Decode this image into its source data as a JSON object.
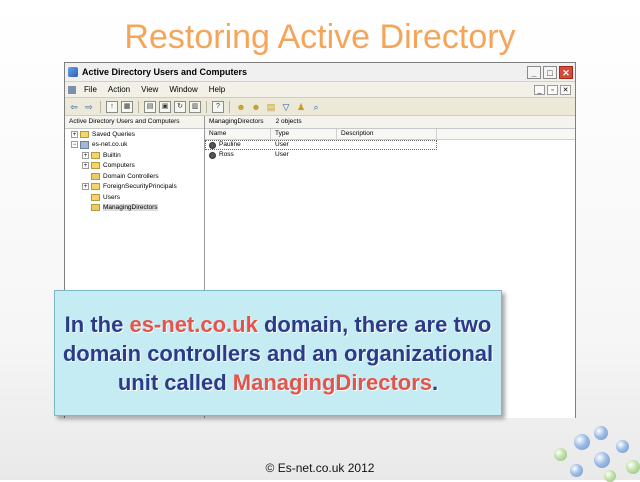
{
  "slide": {
    "title": "Restoring Active Directory",
    "footer": "© Es-net.co.uk 2012"
  },
  "window": {
    "title": "Active Directory Users and Computers",
    "controls": {
      "minimize": "_",
      "maximize": "□",
      "close": "✕"
    },
    "child_controls": {
      "minimize": "_",
      "restore": "▫",
      "close": "✕"
    }
  },
  "menu": {
    "items": [
      "File",
      "Action",
      "View",
      "Window",
      "Help"
    ]
  },
  "tree": {
    "header": "Active Directory Users and Computers",
    "items": [
      {
        "label": "Saved Queries",
        "expander": "+"
      },
      {
        "label": "es-net.co.uk",
        "expander": "−"
      },
      {
        "label": "Builtin",
        "expander": "+"
      },
      {
        "label": "Computers",
        "expander": "+"
      },
      {
        "label": "Domain Controllers",
        "expander": ""
      },
      {
        "label": "ForeignSecurityPrincipals",
        "expander": "+"
      },
      {
        "label": "Users",
        "expander": ""
      },
      {
        "label": "ManagingDirectors",
        "expander": ""
      }
    ]
  },
  "list": {
    "header_title": "ManagingDirectors",
    "header_count": "2 objects",
    "columns": [
      "Name",
      "Type",
      "Description"
    ],
    "rows": [
      {
        "name": "Pauline",
        "type": "User",
        "description": ""
      },
      {
        "name": "Ross",
        "type": "User",
        "description": ""
      }
    ]
  },
  "caption": {
    "part1": "In the ",
    "highlight1": "es-net.co.uk",
    "part2": " domain, there are two domain controllers and an organizational unit called ",
    "highlight2": "ManagingDirectors",
    "part3": "."
  },
  "colors": {
    "title": "#f5a55a",
    "caption_text": "#2b3b88",
    "caption_highlight": "#e6534b",
    "caption_bg": "#c6ecf3"
  }
}
